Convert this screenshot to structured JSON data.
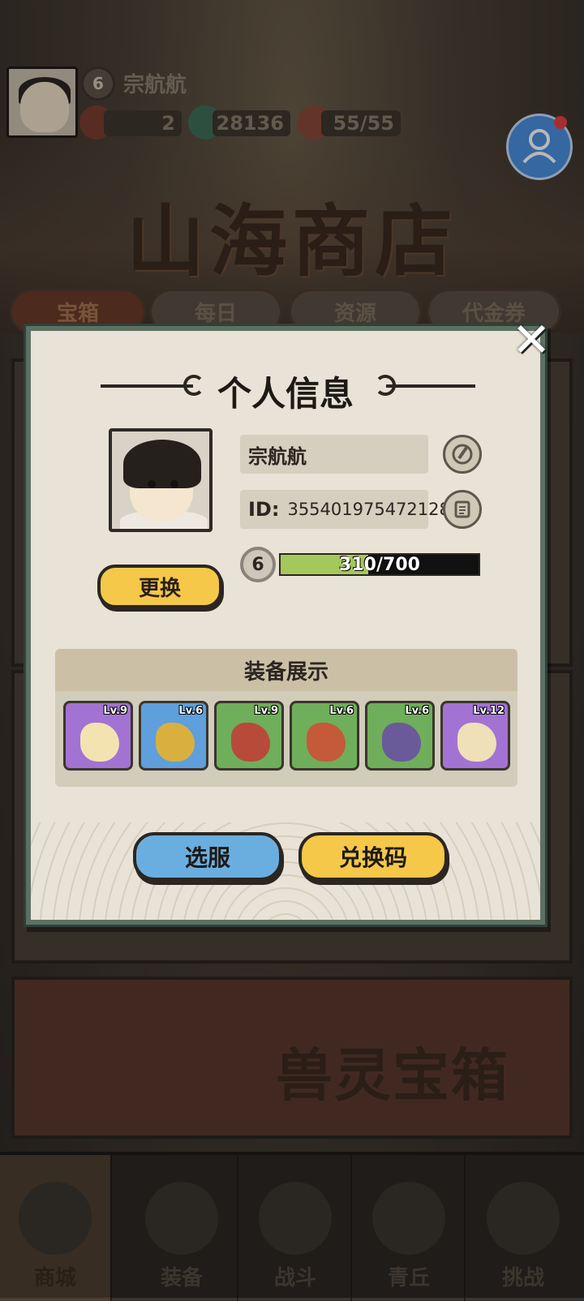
{
  "player": {
    "name": "宗航航",
    "level": "6"
  },
  "resources": [
    {
      "name": "chest-key",
      "value": "2"
    },
    {
      "name": "jade-coin",
      "value": "28136"
    },
    {
      "name": "peach-stamina",
      "value": "55/55"
    }
  ],
  "shop": {
    "title": "山海商店",
    "tabs": [
      "宝箱",
      "每日",
      "资源",
      "代金券"
    ],
    "active_tab": 0,
    "chest_banner": "兽灵宝箱"
  },
  "nav": [
    "商城",
    "装备",
    "战斗",
    "青丘",
    "挑战"
  ],
  "modal": {
    "title": "个人信息",
    "name": "宗航航",
    "id_label": "ID:",
    "id_value": "355401975472128",
    "level": "6",
    "xp_text": "310/700",
    "xp_fraction": 0.443,
    "change_label": "更换",
    "equipment_title": "装备展示",
    "equipment": [
      {
        "level": "Lv.9",
        "rarity": "purple",
        "icon": "feather-staff-icon"
      },
      {
        "level": "Lv.6",
        "rarity": "blue",
        "icon": "golden-armor-icon"
      },
      {
        "level": "Lv.9",
        "rarity": "green",
        "icon": "red-ribbon-icon"
      },
      {
        "level": "Lv.6",
        "rarity": "green",
        "icon": "lotus-belt-icon"
      },
      {
        "level": "Lv.6",
        "rarity": "green",
        "icon": "boots-icon"
      },
      {
        "level": "Lv.12",
        "rarity": "purple",
        "icon": "horn-charm-icon"
      }
    ],
    "server_button": "选服",
    "redeem_button": "兑换码"
  },
  "colors": {
    "modal_border": "#5d7163",
    "xp_fill": "#a4c85a",
    "yellow_button": "#f5c84a",
    "blue_button": "#6aaee0"
  }
}
